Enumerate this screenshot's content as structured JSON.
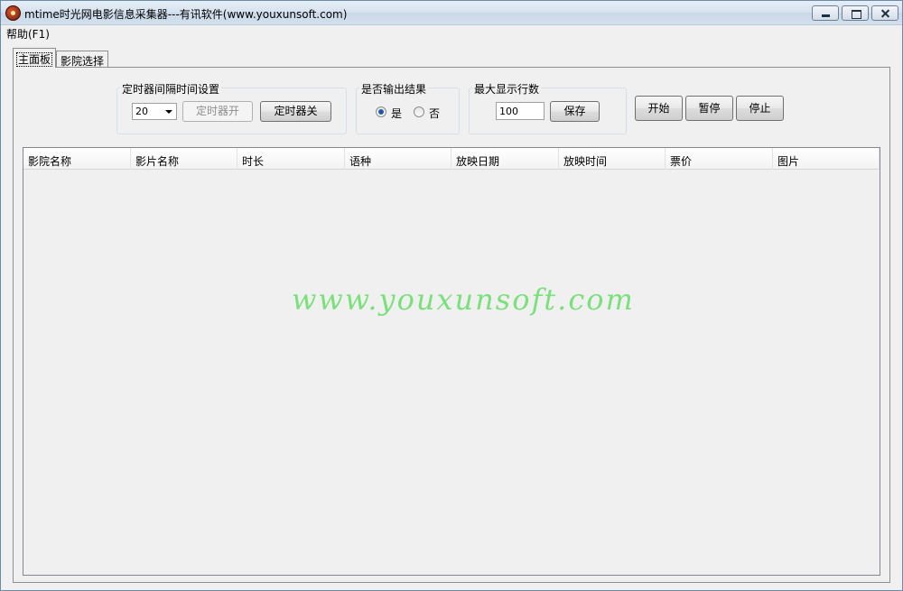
{
  "window": {
    "title": "mtime时光网电影信息采集器---有讯软件(www.youxunsoft.com)"
  },
  "menu": {
    "help": "帮助(F1)"
  },
  "tabs": [
    {
      "label": "主面板"
    },
    {
      "label": "影院选择"
    }
  ],
  "timer_group": {
    "title": "定时器间隔时间设置",
    "interval_value": "20",
    "start_label": "定时器开",
    "stop_label": "定时器关"
  },
  "output_group": {
    "title": "是否输出结果",
    "yes_label": "是",
    "no_label": "否",
    "selected": "是"
  },
  "rows_group": {
    "title": "最大显示行数",
    "value": "100",
    "save_label": "保存"
  },
  "actions": {
    "start": "开始",
    "pause": "暂停",
    "stop": "停止"
  },
  "table": {
    "columns": [
      "影院名称",
      "影片名称",
      "时长",
      "语种",
      "放映日期",
      "放映时间",
      "票价",
      "图片"
    ]
  },
  "watermark": "www.youxunsoft.com"
}
